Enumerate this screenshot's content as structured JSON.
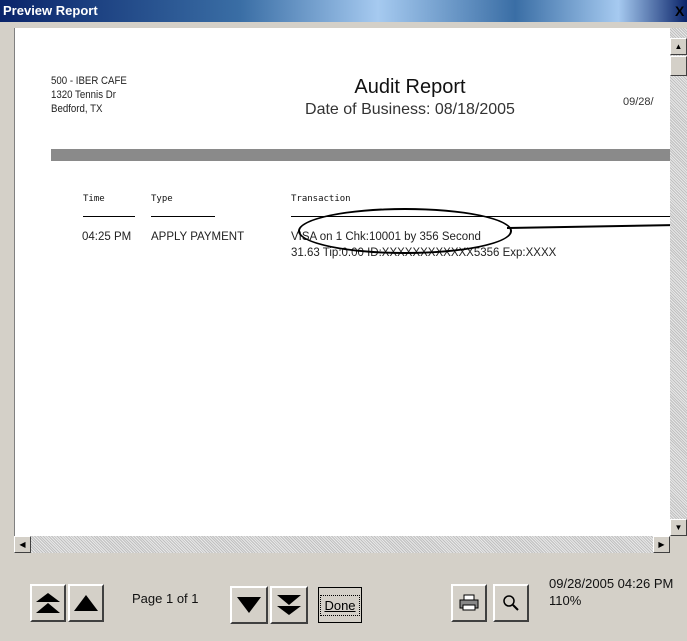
{
  "window": {
    "title": "Preview Report",
    "close_label": "X"
  },
  "report": {
    "company": [
      "500 - IBER CAFE",
      "1320 Tennis Dr",
      "Bedford, TX"
    ],
    "title": "Audit Report",
    "subtitle": "Date of Business: 08/18/2005",
    "print_date": "09/28/",
    "columns": [
      "Time",
      "Type",
      "Transaction"
    ],
    "rows": [
      {
        "time": "04:25 PM",
        "type": "APPLY PAYMENT",
        "line1": "VISA on 1 Chk:10001 by 356 Second",
        "line2": "31.63 Tip:0.00 ID:XXXXXXXXXXXX5356 Exp:XXXX"
      }
    ]
  },
  "toolbar": {
    "page_label": "Page 1 of 1",
    "done_label": "Done",
    "timestamp": "09/28/2005 04:26 PM",
    "zoom": "110%"
  },
  "icons": {
    "first": "first-page-icon",
    "prev": "previous-page-icon",
    "next": "next-page-icon",
    "last": "last-page-icon",
    "print": "printer-icon",
    "zoom": "magnifier-icon"
  }
}
